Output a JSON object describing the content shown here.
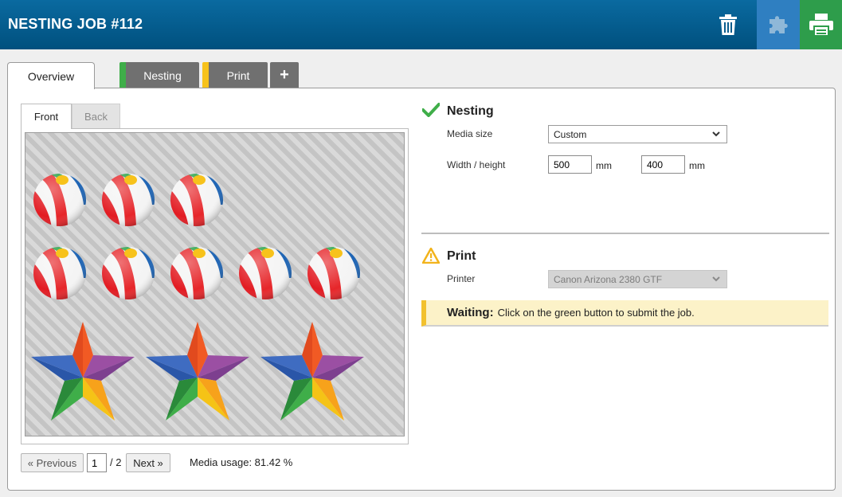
{
  "header": {
    "title": "NESTING JOB #112",
    "colors": {
      "bar": "#00507e",
      "nest_button": "#2f7fc1",
      "print_button": "#2e9d4b"
    }
  },
  "tabs": [
    {
      "label": "Overview",
      "active": true
    },
    {
      "label": "Nesting",
      "stripe_color": "#3fae49"
    },
    {
      "label": "Print",
      "stripe_color": "#f7c21b"
    },
    {
      "label": "+"
    }
  ],
  "preview": {
    "subtabs": [
      {
        "label": "Front",
        "active": true
      },
      {
        "label": "Back",
        "active": false
      }
    ],
    "artwork_icons": [
      "beach-ball-icon",
      "star-icon"
    ]
  },
  "pager": {
    "previous_label": "« Previous",
    "page_value": "1",
    "total_label": "/ 2",
    "next_label": "Next »",
    "usage_label": "Media usage: 81.42 %"
  },
  "nesting": {
    "title": "Nesting",
    "status_icon": "checkmark-icon",
    "media_size_label": "Media size",
    "media_size_value": "Custom",
    "width_height_label": "Width / height",
    "width_value": "500",
    "height_value": "400",
    "unit": "mm"
  },
  "print": {
    "title": "Print",
    "status_icon": "warning-icon",
    "printer_label": "Printer",
    "printer_value": "Canon Arizona 2380 GTF",
    "waiting_label": "Waiting:",
    "waiting_message": "Click on the green button to submit the job."
  }
}
